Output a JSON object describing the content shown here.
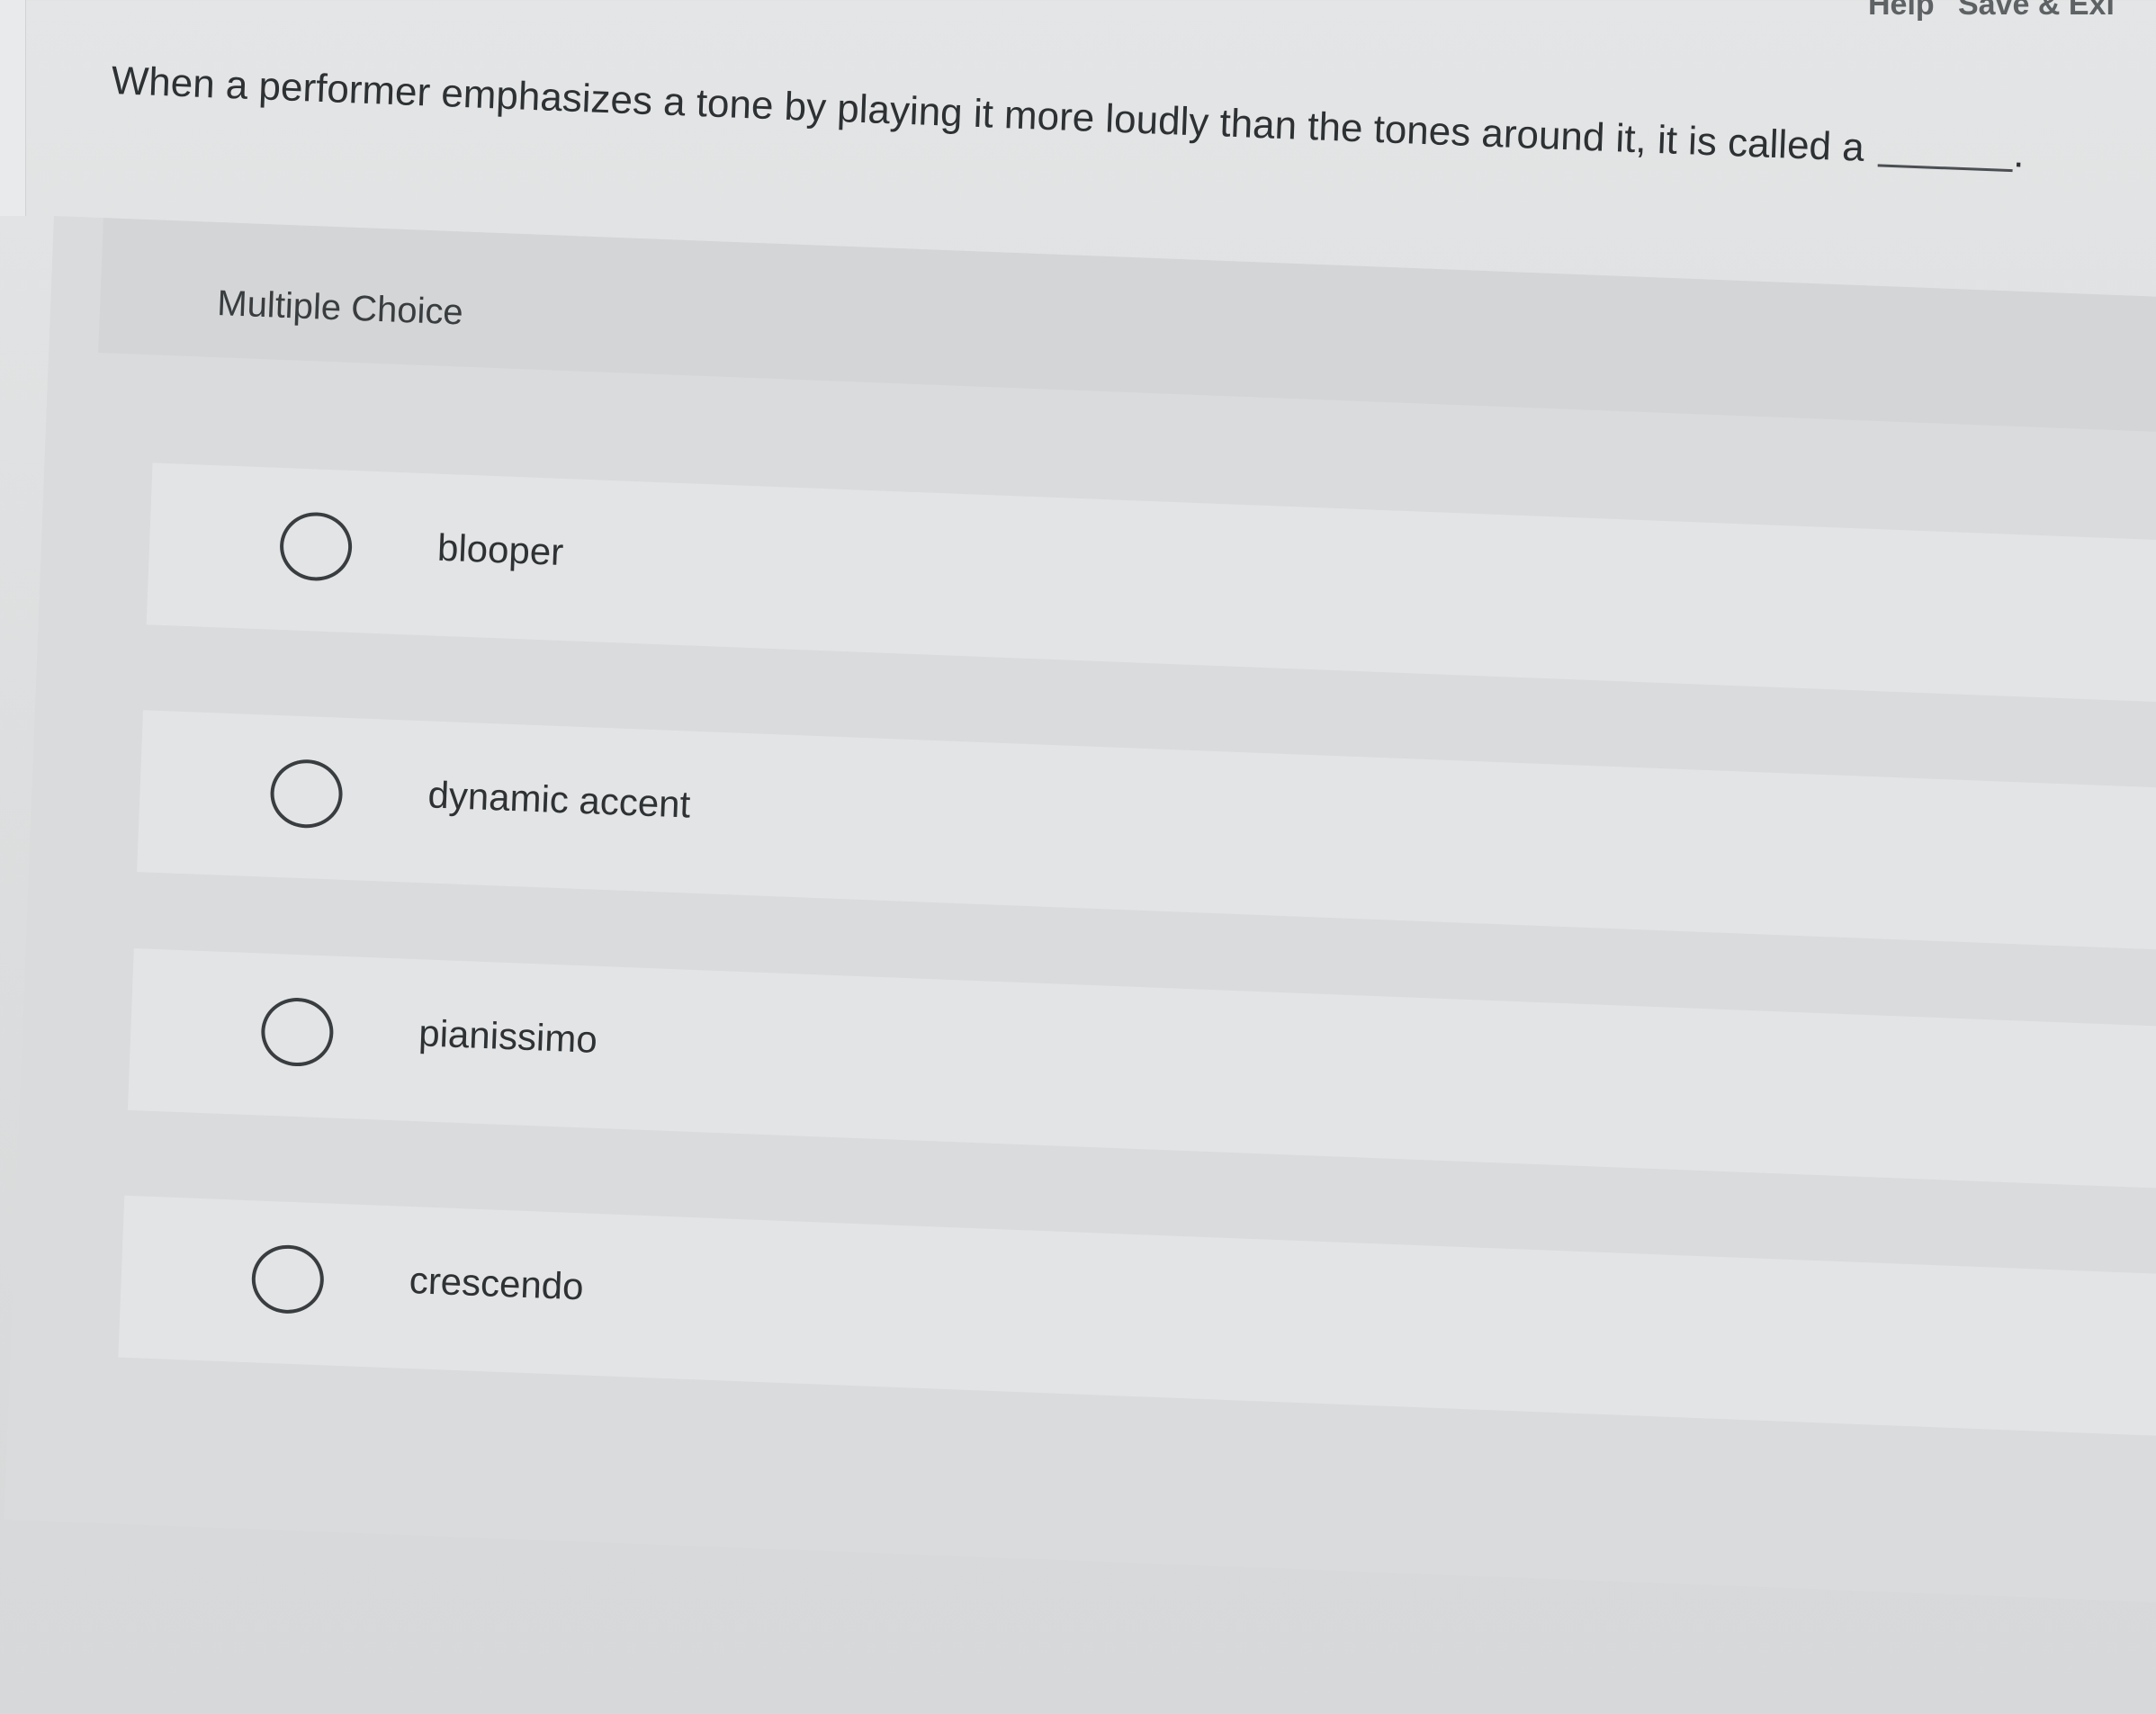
{
  "header": {
    "help_label": "Help",
    "save_exit_label": "Save & Exi"
  },
  "question": {
    "text": "When a performer emphasizes a tone by playing it more loudly than the tones around it, it is called a",
    "end_punct": "."
  },
  "question_type": "Multiple Choice",
  "options": [
    {
      "label": "blooper",
      "selected": false
    },
    {
      "label": "dynamic accent",
      "selected": false
    },
    {
      "label": "pianissimo",
      "selected": false
    },
    {
      "label": "crescendo",
      "selected": false
    }
  ]
}
